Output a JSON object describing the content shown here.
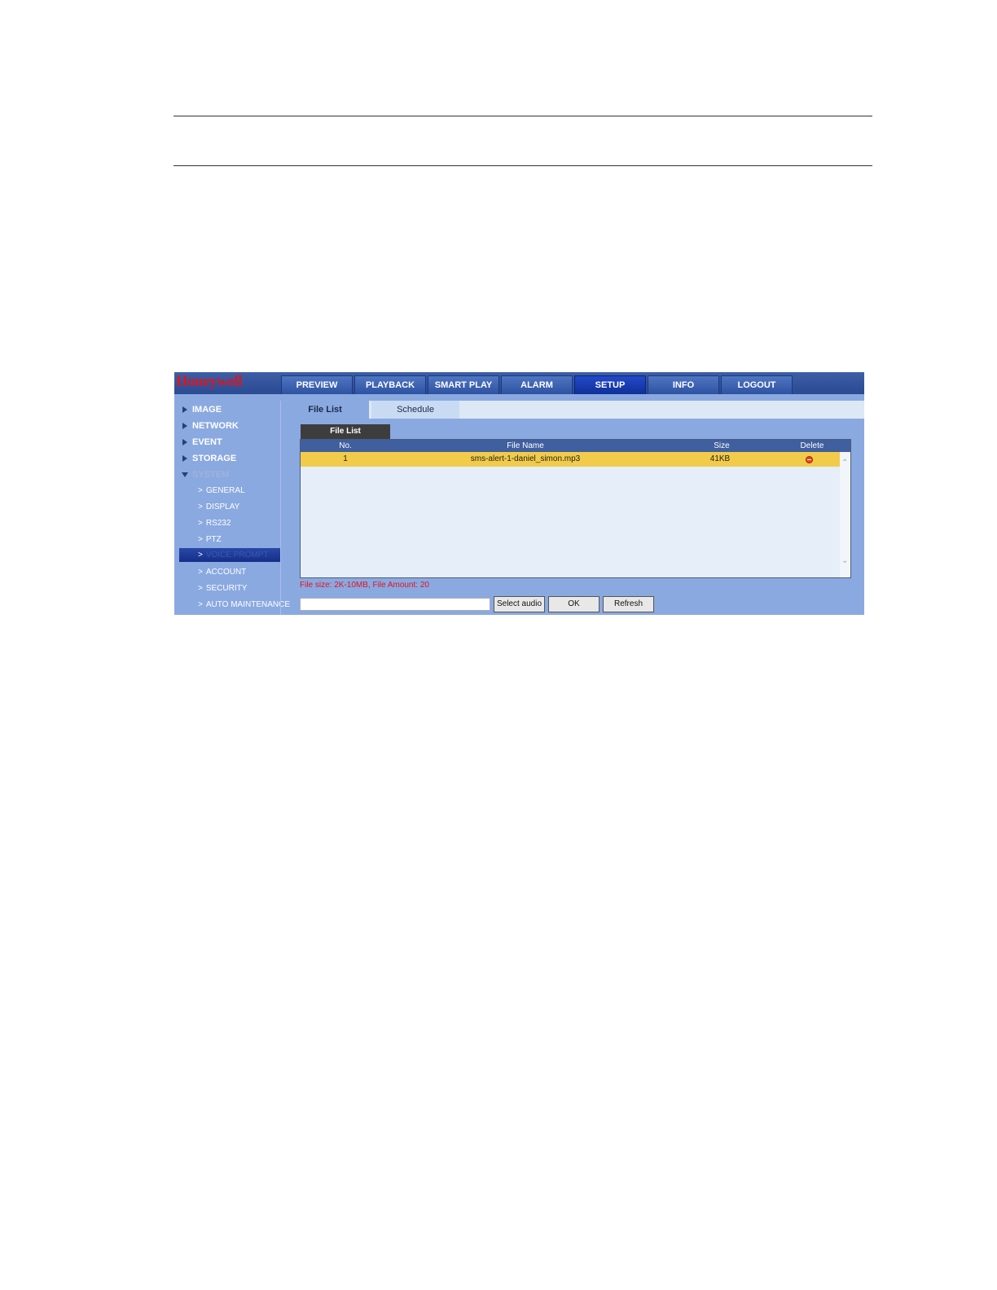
{
  "app": {
    "logo": "Honeywell"
  },
  "nav": {
    "items": [
      "PREVIEW",
      "PLAYBACK",
      "SMART PLAY",
      "ALARM",
      "SETUP",
      "INFO",
      "LOGOUT"
    ],
    "active": "SETUP"
  },
  "sidebar": {
    "top_items": [
      "IMAGE",
      "NETWORK",
      "EVENT",
      "STORAGE",
      "SYSTEM"
    ],
    "sub_items": [
      "GENERAL",
      "DISPLAY",
      "RS232",
      "PTZ",
      "VOICE PROMPT",
      "ACCOUNT",
      "SECURITY",
      "AUTO MAINTENANCE"
    ],
    "selected": "VOICE PROMPT",
    "expanded": "SYSTEM"
  },
  "tabs": {
    "file_list": "File List",
    "schedule": "Schedule"
  },
  "panel": {
    "subtab": "File List"
  },
  "table": {
    "columns": {
      "no": "No.",
      "file_name": "File Name",
      "size": "Size",
      "delete": "Delete"
    },
    "rows": [
      {
        "no": "1",
        "file_name": "sms-alert-1-daniel_simon.mp3",
        "size": "41KB"
      }
    ]
  },
  "note": "File size: 2K-10MB, File Amount: 20",
  "footer": {
    "input_value": "",
    "select_audio": "Select audio",
    "ok": "OK",
    "refresh": "Refresh"
  },
  "colors": {
    "brand": "#d21a22",
    "panel": "#8aa9e0",
    "highlight_row": "#f2cb4a",
    "note": "#e0141e"
  },
  "icons": {
    "delete": "delete-icon",
    "collapsed": "triangle-right-icon",
    "expanded": "triangle-down-icon"
  }
}
